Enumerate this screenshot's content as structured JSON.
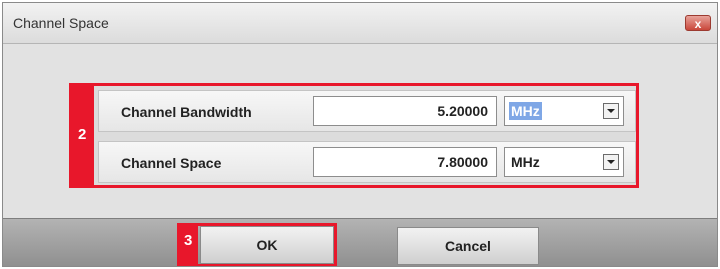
{
  "window": {
    "title": "Channel Space",
    "close_glyph": "x"
  },
  "group": {
    "badge": "2",
    "rows": [
      {
        "label": "Channel Bandwidth",
        "value": "5.20000",
        "unit": "MHz"
      },
      {
        "label": "Channel Space",
        "value": "7.80000",
        "unit": "MHz"
      }
    ]
  },
  "footer": {
    "ok_badge": "3",
    "ok_label": "OK",
    "cancel_label": "Cancel"
  },
  "colors": {
    "highlight": "#e8172b",
    "selection": "#7fa7e6"
  },
  "icons": {
    "close": "close-icon",
    "dropdown": "chevron-down-icon"
  }
}
